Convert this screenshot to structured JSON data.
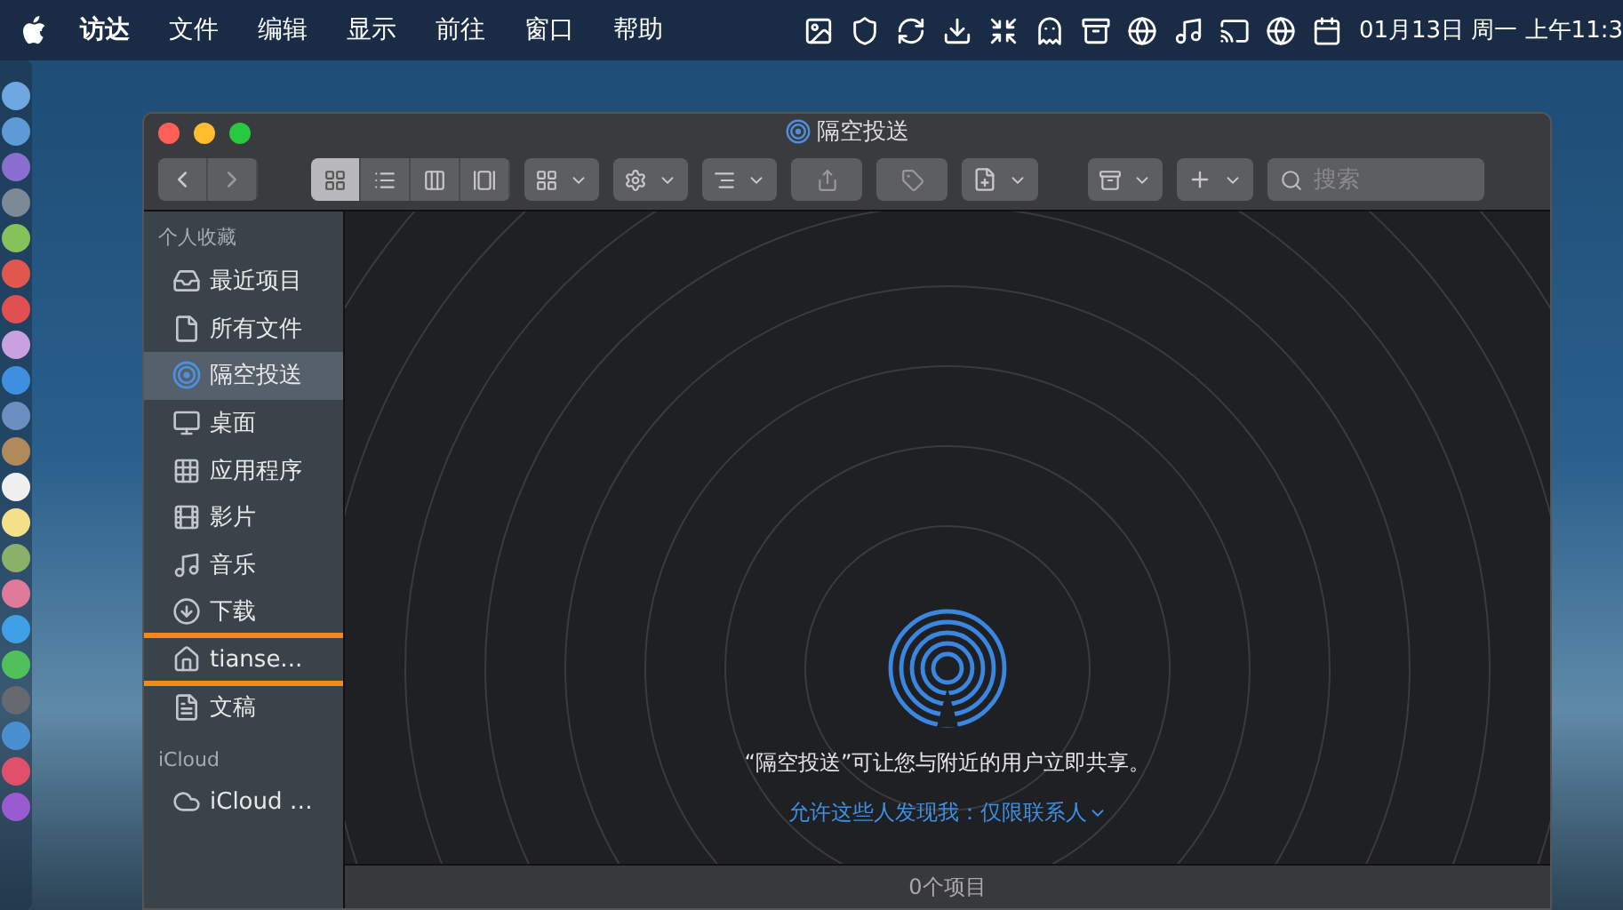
{
  "menu_bar": {
    "app": "访达",
    "items": [
      "文件",
      "编辑",
      "显示",
      "前往",
      "窗口",
      "帮助"
    ],
    "clock": "01月13日 周一 上午11:3"
  },
  "window": {
    "title": "隔空投送"
  },
  "toolbar": {
    "view_modes": [
      {
        "kind": "icons",
        "selected": true
      },
      {
        "kind": "list",
        "selected": false
      },
      {
        "kind": "columns",
        "selected": false
      },
      {
        "kind": "gallery",
        "selected": false
      }
    ],
    "search": {
      "placeholder": "搜索"
    }
  },
  "sidebar": {
    "sections": [
      {
        "heading": "个人收藏",
        "items": [
          {
            "label": "最近项目",
            "kind": "recents",
            "selected": false,
            "highlighted": false
          },
          {
            "label": "所有文件",
            "kind": "file",
            "selected": false,
            "highlighted": false
          },
          {
            "label": "隔空投送",
            "kind": "airdrop",
            "selected": true,
            "highlighted": false
          },
          {
            "label": "桌面",
            "kind": "desktop",
            "selected": false,
            "highlighted": false
          },
          {
            "label": "应用程序",
            "kind": "apps",
            "selected": false,
            "highlighted": false
          },
          {
            "label": "影片",
            "kind": "movies",
            "selected": false,
            "highlighted": false
          },
          {
            "label": "音乐",
            "kind": "music",
            "selected": false,
            "highlighted": false
          },
          {
            "label": "下载",
            "kind": "downloads",
            "selected": false,
            "highlighted": false
          },
          {
            "label": "tianse...",
            "kind": "home",
            "selected": false,
            "highlighted": true
          },
          {
            "label": "文稿",
            "kind": "documents",
            "selected": false,
            "highlighted": false
          }
        ]
      },
      {
        "heading": "iCloud",
        "items": [
          {
            "label": "iCloud …",
            "kind": "cloud",
            "selected": false,
            "highlighted": false
          }
        ]
      }
    ]
  },
  "airdrop": {
    "message": "“隔空投送”可让您与附近的用户立即共享。",
    "discover_label": "允许这些人发现我：",
    "discover_value": "仅限联系人"
  },
  "status_bar": {
    "text": "0个项目"
  }
}
